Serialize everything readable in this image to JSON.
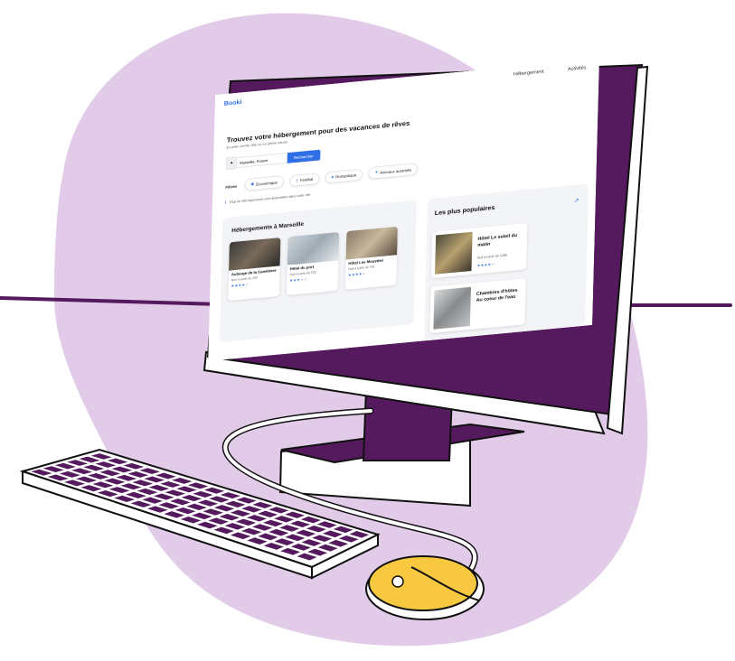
{
  "colors": {
    "blob": "#e2cbe9",
    "monitor": "#551a5d",
    "mouse": "#f7c840",
    "accent": "#2f6fe6"
  },
  "screen": {
    "brand": "Booki",
    "nav": [
      "Hébergement",
      "Activités"
    ],
    "hero": {
      "title": "Trouvez votre hébergement pour des vacances de rêves",
      "subtitle": "En plein centre-ville ou en pleine nature"
    },
    "search": {
      "value": "Marseille, France",
      "button": "Rechercher",
      "location_icon": "map-pin-icon"
    },
    "filters": {
      "label": "Filtres",
      "items": [
        {
          "label": "Économique",
          "icon": "money-icon"
        },
        {
          "label": "Familial",
          "icon": "family-icon"
        },
        {
          "label": "Romantique",
          "icon": "heart-icon"
        },
        {
          "label": "Animaux autorisés",
          "icon": "paw-icon"
        }
      ]
    },
    "info": "Plus de 500 logements sont disponibles dans cette ville",
    "listing": {
      "title": "Hébergements à Marseille",
      "cards": [
        {
          "name": "Auberge de la Canebiere",
          "price": "Nuit à partir de 25€",
          "rating": 4
        },
        {
          "name": "Hôtel du port",
          "price": "Nuit à partir de 52€",
          "rating": 3
        },
        {
          "name": "Hôtel Les Mouettes",
          "price": "Nuit à partir de 76€",
          "rating": 4
        }
      ]
    },
    "popular": {
      "title": "Les plus populaires",
      "icon": "trending-up-icon",
      "cards": [
        {
          "name": "Hôtel Le soleil du matin",
          "price": "Nuit à partir de 128€",
          "rating": 4
        },
        {
          "name": "Chambres d'hôtes Au coeur de l'eau",
          "price": "",
          "rating": 0
        }
      ]
    }
  }
}
